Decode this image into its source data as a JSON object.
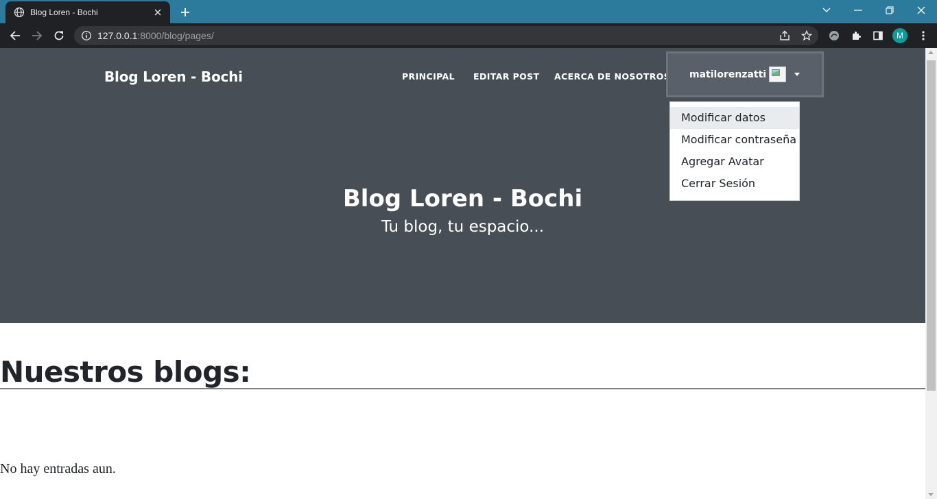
{
  "browser": {
    "tab_title": "Blog Loren - Bochi",
    "url_host": "127.0.0.1",
    "url_path": ":8000/blog/pages/",
    "profile_initial": "M"
  },
  "navbar": {
    "brand": "Blog Loren - Bochi",
    "links": [
      "PRINCIPAL",
      "EDITAR POST",
      "ACERCA DE NOSOTROS"
    ],
    "username": "matilorenzatti"
  },
  "user_menu": {
    "items": [
      "Modificar datos",
      "Modificar contraseña",
      "Agregar Avatar",
      "Cerrar Sesión"
    ],
    "highlighted": "Modificar datos"
  },
  "hero": {
    "title": "Blog Loren - Bochi",
    "subtitle": "Tu blog, tu espacio..."
  },
  "content": {
    "section_title": "Nuestros blogs:",
    "empty_message": "No hay entradas aun."
  },
  "colors": {
    "tabbar": "#2c7b9c",
    "chrome_dark": "#1f2125",
    "masthead": "#474e56",
    "profile_badge": "#0f9d9a"
  }
}
